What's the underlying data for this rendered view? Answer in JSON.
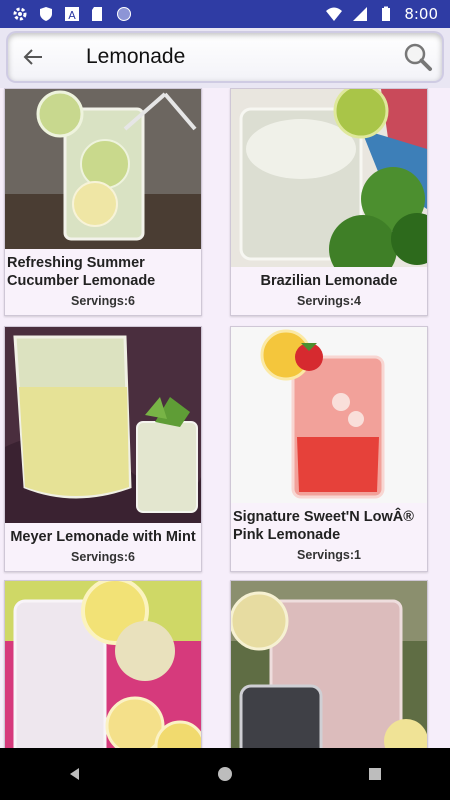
{
  "status_bar": {
    "time": "8:00"
  },
  "search": {
    "query": "Lemonade"
  },
  "recipes": [
    {
      "title": "Refreshing Summer Cucumber Lemonade",
      "servings": "Servings:6"
    },
    {
      "title": "Brazilian Lemonade",
      "servings": "Servings:4"
    },
    {
      "title": "Meyer Lemonade with Mint",
      "servings": "Servings:6"
    },
    {
      "title": "Signature Sweet'N LowÂ® Pink Lemonade",
      "servings": "Servings:1"
    },
    {
      "title": "",
      "servings": ""
    },
    {
      "title": "",
      "servings": ""
    }
  ],
  "colors": {
    "status_bar": "#2f3ca4",
    "card_bg": "#f9f2fb",
    "page_bg": "#f6eefa"
  }
}
